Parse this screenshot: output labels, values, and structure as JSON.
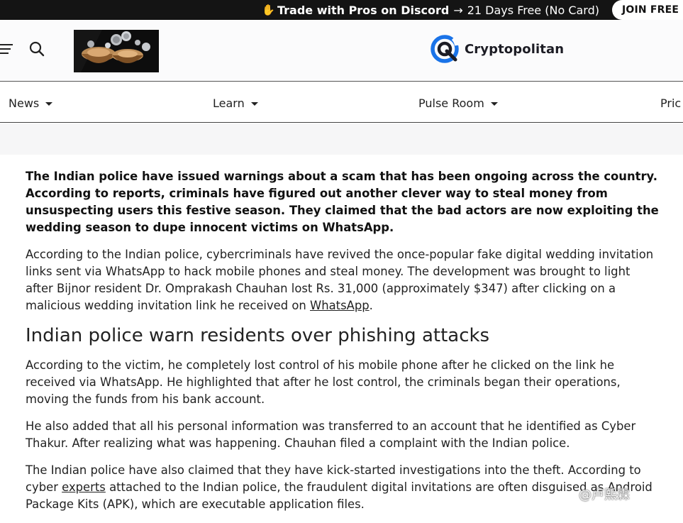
{
  "promo": {
    "icon": "hand-icon",
    "bold_text": "Trade with Pros on Discord",
    "arrow": "→",
    "light_text": "21 Days Free (No Card)",
    "button_label": "JOIN FREE"
  },
  "header": {
    "menu_icon": "hamburger-icon",
    "search_icon": "search-icon",
    "logo_text": "Cryptopolitan",
    "brand_color": "#1a73e8"
  },
  "nav": {
    "items": [
      {
        "label": "News"
      },
      {
        "label": "Learn"
      },
      {
        "label": "Pulse Room"
      },
      {
        "label": "Pric"
      }
    ]
  },
  "article": {
    "lead": "The Indian police have issued warnings about a scam that has been ongoing across the country. According to reports, criminals have figured out another clever way to steal money from unsuspecting users this festive season. They claimed that the bad actors are now exploiting the wedding season to dupe innocent victims on WhatsApp.",
    "p1_text": "According to the Indian police, cybercriminals have revived the once-popular fake digital wedding invitation links sent via WhatsApp to hack mobile phones and steal money. The development was brought to light after Bijnor resident Dr. Omprakash Chauhan lost Rs. 31,000 (approximately $347) after clicking on a malicious wedding invitation link he received on ",
    "p1_link": "WhatsApp",
    "p1_end": ".",
    "heading": "Indian police warn residents over phishing attacks",
    "p2": "According to the victim, he completely lost control of his mobile phone after he clicked on the link he received via WhatsApp. He highlighted that after he lost control, the criminals began their operations, moving the funds from his bank account.",
    "p3": "He also added that all his personal information was transferred to an account that he identified as Cyber Thakur. After realizing what was happening. Chauhan filed a complaint with the Indian police.",
    "p4_start": "The Indian police have also claimed that they have kick-started investigations into the theft. According to cyber ",
    "p4_link": "experts",
    "p4_end": " attached to the Indian police, the fraudulent digital invitations are often disguised as Android Package Kits (APK), which are executable application files."
  },
  "watermark": "@卢熙霖"
}
